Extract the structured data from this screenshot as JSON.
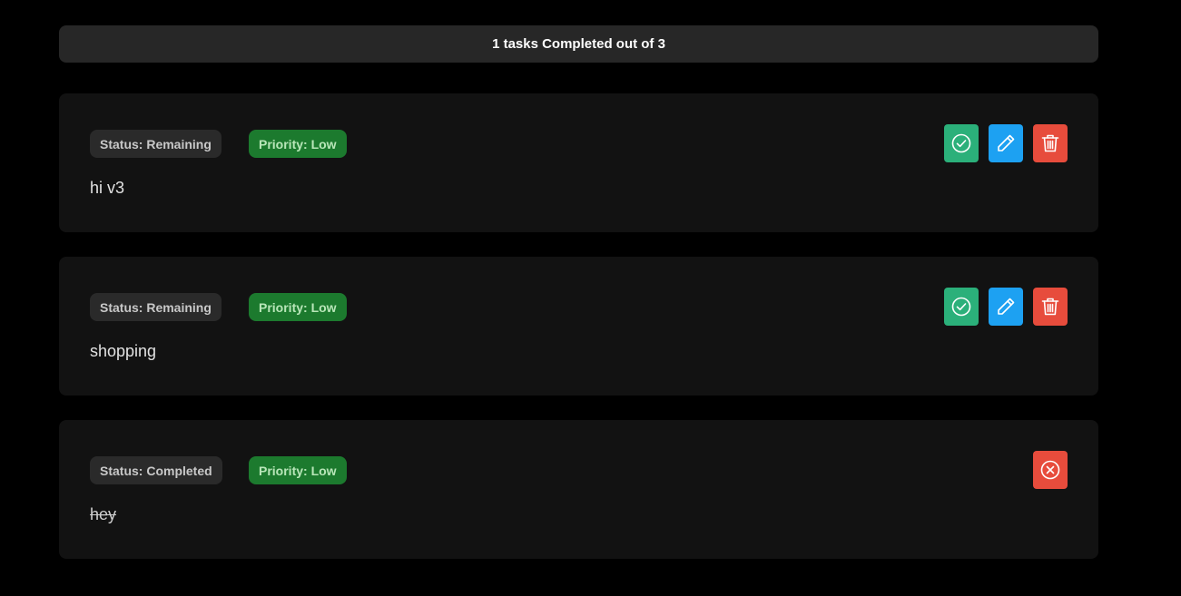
{
  "summary": {
    "text": "1 tasks Completed out of 3"
  },
  "tasks": [
    {
      "status_label": "Status: Remaining",
      "priority_label": "Priority: Low",
      "text": "hi v3",
      "completed": false
    },
    {
      "status_label": "Status: Remaining",
      "priority_label": "Priority: Low",
      "text": "shopping",
      "completed": false
    },
    {
      "status_label": "Status: Completed",
      "priority_label": "Priority: Low",
      "text": "hey",
      "completed": true
    }
  ],
  "icons": {
    "complete": "check-circle-icon",
    "edit": "pencil-icon",
    "delete": "trash-icon",
    "undo": "x-circle-icon"
  },
  "colors": {
    "background": "#000000",
    "card": "#121212",
    "summary_bar": "#272727",
    "status_badge": "#2a2a2a",
    "priority_low": "#1c7a2e",
    "complete_button": "#2bb07a",
    "edit_button": "#1da1f2",
    "delete_button": "#e74c3c"
  }
}
